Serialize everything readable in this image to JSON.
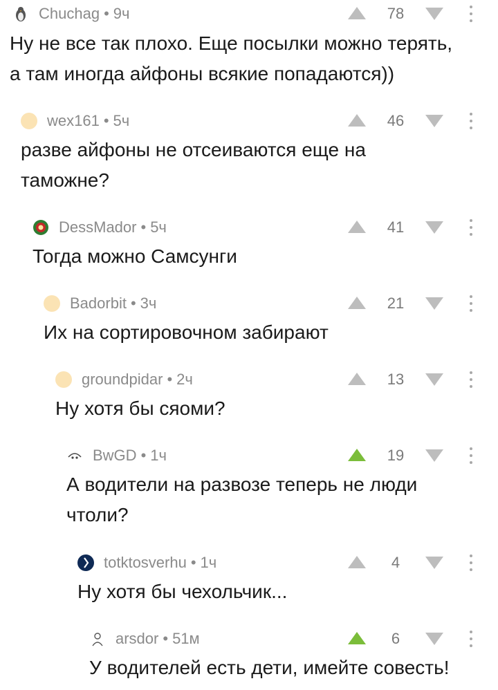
{
  "comments": [
    {
      "author": "Chuchag",
      "time": "9ч",
      "score": "78",
      "upvoted": false,
      "avatar": "penguin-avatar",
      "lines": [
        "Ну не все так плохо. Еще посылки можно терять,",
        "а там иногда айфоны всякие попадаются))"
      ]
    },
    {
      "author": "wex161",
      "time": "5ч",
      "score": "46",
      "upvoted": false,
      "avatar": "default-avatar",
      "lines": [
        "разве айфоны не отсеиваются еще на",
        "таможне?"
      ]
    },
    {
      "author": "DessMador",
      "time": "5ч",
      "score": "41",
      "upvoted": false,
      "avatar": "emblem-avatar",
      "lines": [
        "Тогда можно Самсунги"
      ]
    },
    {
      "author": "Badorbit",
      "time": "3ч",
      "score": "21",
      "upvoted": false,
      "avatar": "default-avatar",
      "lines": [
        "Их на сортировочном забирают"
      ]
    },
    {
      "author": "groundpidar",
      "time": "2ч",
      "score": "13",
      "upvoted": false,
      "avatar": "default-avatar",
      "lines": [
        "Ну хотя бы сяоми?"
      ]
    },
    {
      "author": "BwGD",
      "time": "1ч",
      "score": "19",
      "upvoted": true,
      "avatar": "face-avatar",
      "lines": [
        "А водители на развозе теперь не люди",
        "чтоли?"
      ]
    },
    {
      "author": "totktosverhu",
      "time": "1ч",
      "score": "4",
      "upvoted": false,
      "avatar": "dark-avatar",
      "lines": [
        "Ну хотя бы чехольчик..."
      ]
    },
    {
      "author": "arsdor",
      "time": "51м",
      "score": "6",
      "upvoted": true,
      "avatar": "sketch-avatar",
      "lines": [
        "У водителей есть дети, имейте совесть!"
      ]
    }
  ],
  "separator": "•",
  "colors": {
    "upvote_active": "#7bbd3a",
    "vote_inactive": "#bdbdbd",
    "meta_text": "#8a8a8a",
    "thread_line": "#d7d7d7"
  }
}
